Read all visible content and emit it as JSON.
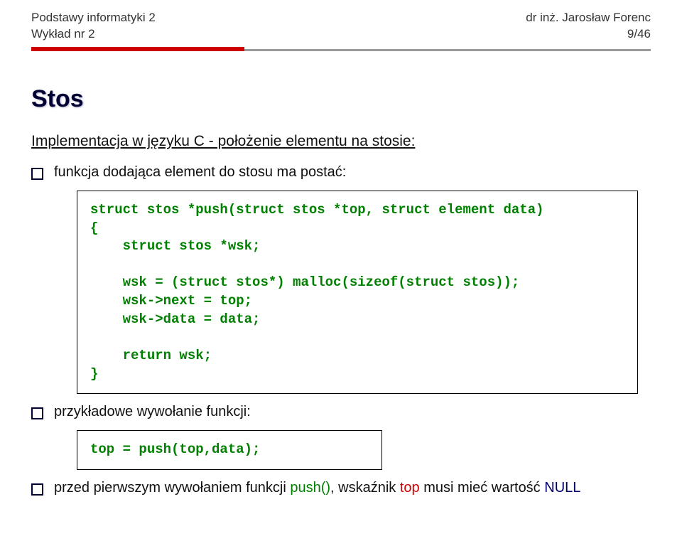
{
  "header": {
    "left1": "Podstawy informatyki 2",
    "left2": "Wykład nr 2",
    "right1": "dr inż. Jarosław Forenc",
    "right2": "9/46"
  },
  "title": "Stos",
  "subtitle": "Implementacja w języku C - położenie elementu na stosie:",
  "bullet1": "funkcja dodająca element do stosu ma postać:",
  "code1": "struct stos *push(struct stos *top, struct element data)\n{\n    struct stos *wsk;\n\n    wsk = (struct stos*) malloc(sizeof(struct stos));\n    wsk->next = top;\n    wsk->data = data;\n\n    return wsk;\n}",
  "bullet2": "przykładowe wywołanie funkcji:",
  "code2": "top = push(top,data);",
  "bullet3_parts": {
    "p1": "przed pierwszym wywołaniem funkcji ",
    "p2": "push()",
    "p3": ", wskaźnik ",
    "p4": "top",
    "p5": " musi mieć wartość ",
    "p6": "NULL"
  }
}
